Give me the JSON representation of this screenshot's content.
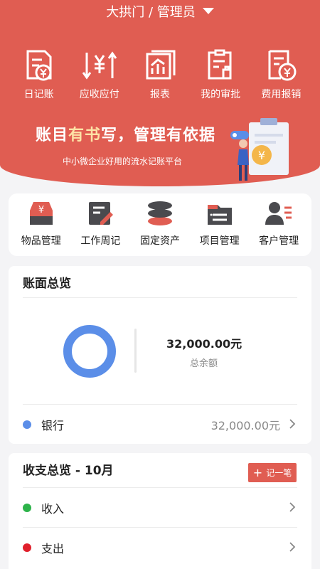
{
  "header": {
    "title": "大拱门 / 管理员",
    "quick_actions": [
      {
        "label": "日记账",
        "icon": "journal-icon"
      },
      {
        "label": "应收应付",
        "icon": "receivable-payable-icon"
      },
      {
        "label": "报表",
        "icon": "report-icon"
      },
      {
        "label": "我的审批",
        "icon": "approval-icon"
      },
      {
        "label": "费用报销",
        "icon": "expense-reimburse-icon"
      }
    ],
    "banner": {
      "slogan_part1": "账目",
      "slogan_highlight": "有书",
      "slogan_part2": "写，管理有依据",
      "subtitle": "中小微企业好用的流水记账平台"
    }
  },
  "modules": [
    {
      "label": "物品管理",
      "icon": "inventory-icon"
    },
    {
      "label": "工作周记",
      "icon": "weekly-note-icon"
    },
    {
      "label": "固定资产",
      "icon": "fixed-asset-icon"
    },
    {
      "label": "项目管理",
      "icon": "project-folder-icon"
    },
    {
      "label": "客户管理",
      "icon": "customer-icon"
    }
  ],
  "balance": {
    "title": "账面总览",
    "total_amount": "32,000.00元",
    "total_label": "总余额",
    "accounts": [
      {
        "label": "银行",
        "value": "32,000.00元",
        "color": "#5b8ee8"
      }
    ]
  },
  "income_expense": {
    "title": "收支总览 - 10月",
    "add_label": "记一笔",
    "rows": [
      {
        "label": "收入",
        "color": "#2db34a"
      },
      {
        "label": "支出",
        "color": "#e0202c"
      }
    ]
  },
  "colors": {
    "brand": "#e05d52",
    "donut": "#5b8ee8",
    "banner_highlight": "#fde2a6"
  }
}
